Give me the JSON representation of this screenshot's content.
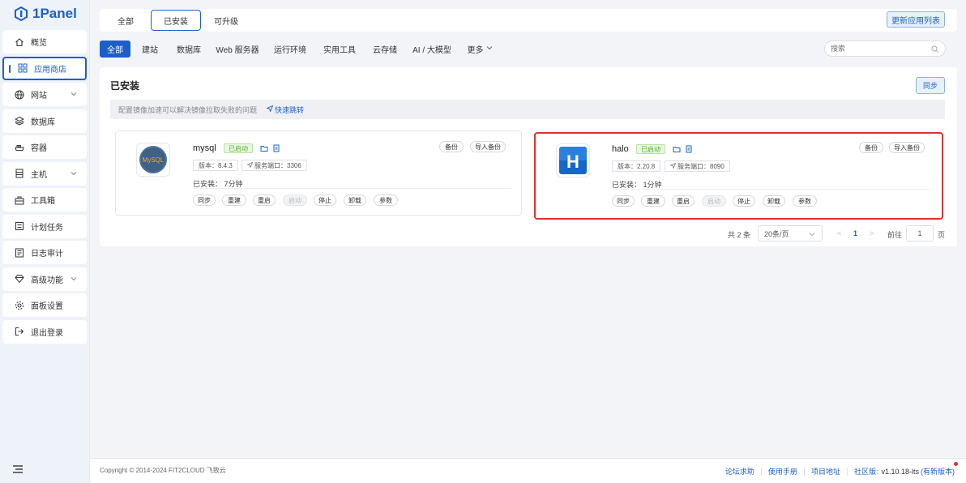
{
  "app": {
    "logo_text": "1Panel"
  },
  "sidebar": {
    "items": [
      {
        "label": "概览",
        "icon": "home-icon"
      },
      {
        "label": "应用商店",
        "icon": "grid-icon",
        "active": true
      },
      {
        "label": "网站",
        "icon": "globe-icon",
        "has_children": true
      },
      {
        "label": "数据库",
        "icon": "layers-icon"
      },
      {
        "label": "容器",
        "icon": "container-icon"
      },
      {
        "label": "主机",
        "icon": "server-icon",
        "has_children": true
      },
      {
        "label": "工具箱",
        "icon": "toolbox-icon"
      },
      {
        "label": "计划任务",
        "icon": "list-icon"
      },
      {
        "label": "日志审计",
        "icon": "log-icon"
      },
      {
        "label": "高级功能",
        "icon": "diamond-icon",
        "has_children": true
      },
      {
        "label": "面板设置",
        "icon": "gear-icon"
      },
      {
        "label": "退出登录",
        "icon": "logout-icon"
      }
    ]
  },
  "topbar": {
    "tabs": [
      "全部",
      "已安装",
      "可升级"
    ],
    "active_tab": "已安装",
    "update_button": "更新应用列表"
  },
  "categories": {
    "items": [
      "全部",
      "建站",
      "数据库",
      "Web 服务器",
      "运行环境",
      "实用工具",
      "云存储",
      "AI / 大模型",
      "更多"
    ],
    "active": "全部",
    "search_placeholder": "搜索"
  },
  "panel": {
    "title": "已安装",
    "sync_button": "同步",
    "notice_text": "配置镜像加速可以解决镜像拉取失败的问题",
    "notice_link": "快速跳转"
  },
  "apps": [
    {
      "name": "mysql",
      "status": "已启动",
      "version_tag": "版本：8.4.3",
      "port_tag": "服务端口：3306",
      "installed": "已安装：  7分钟",
      "top_actions": [
        "备份",
        "导入备份"
      ],
      "actions": [
        "同步",
        "重建",
        "重启",
        "启动",
        "停止",
        "卸载",
        "参数"
      ],
      "disabled_action": "启动"
    },
    {
      "name": "halo",
      "status": "已启动",
      "version_tag": "版本：2.20.8",
      "port_tag": "服务端口：8090",
      "installed": "已安装：  1分钟",
      "top_actions": [
        "备份",
        "导入备份"
      ],
      "actions": [
        "同步",
        "重建",
        "重启",
        "启动",
        "停止",
        "卸载",
        "参数"
      ],
      "disabled_action": "启动",
      "highlighted": true
    }
  ],
  "pagination": {
    "total": "共 2 条",
    "page_size": "20条/页",
    "prev": "<",
    "current": "1",
    "next": ">",
    "goto_label": "前往",
    "goto_value": "1",
    "page_unit": "页"
  },
  "footer": {
    "copyright": "Copyright © 2014-2024 FIT2CLOUD 飞致云",
    "links": [
      "论坛求助",
      "使用手册",
      "项目地址"
    ],
    "edition": "社区版:",
    "version": "v1.10.18-lts",
    "new_version": "(有新版本)"
  },
  "colors": {
    "accent": "#1d5fc9",
    "success": "#52b126",
    "highlight_border": "#e03131",
    "background": "#f2f4f8"
  }
}
